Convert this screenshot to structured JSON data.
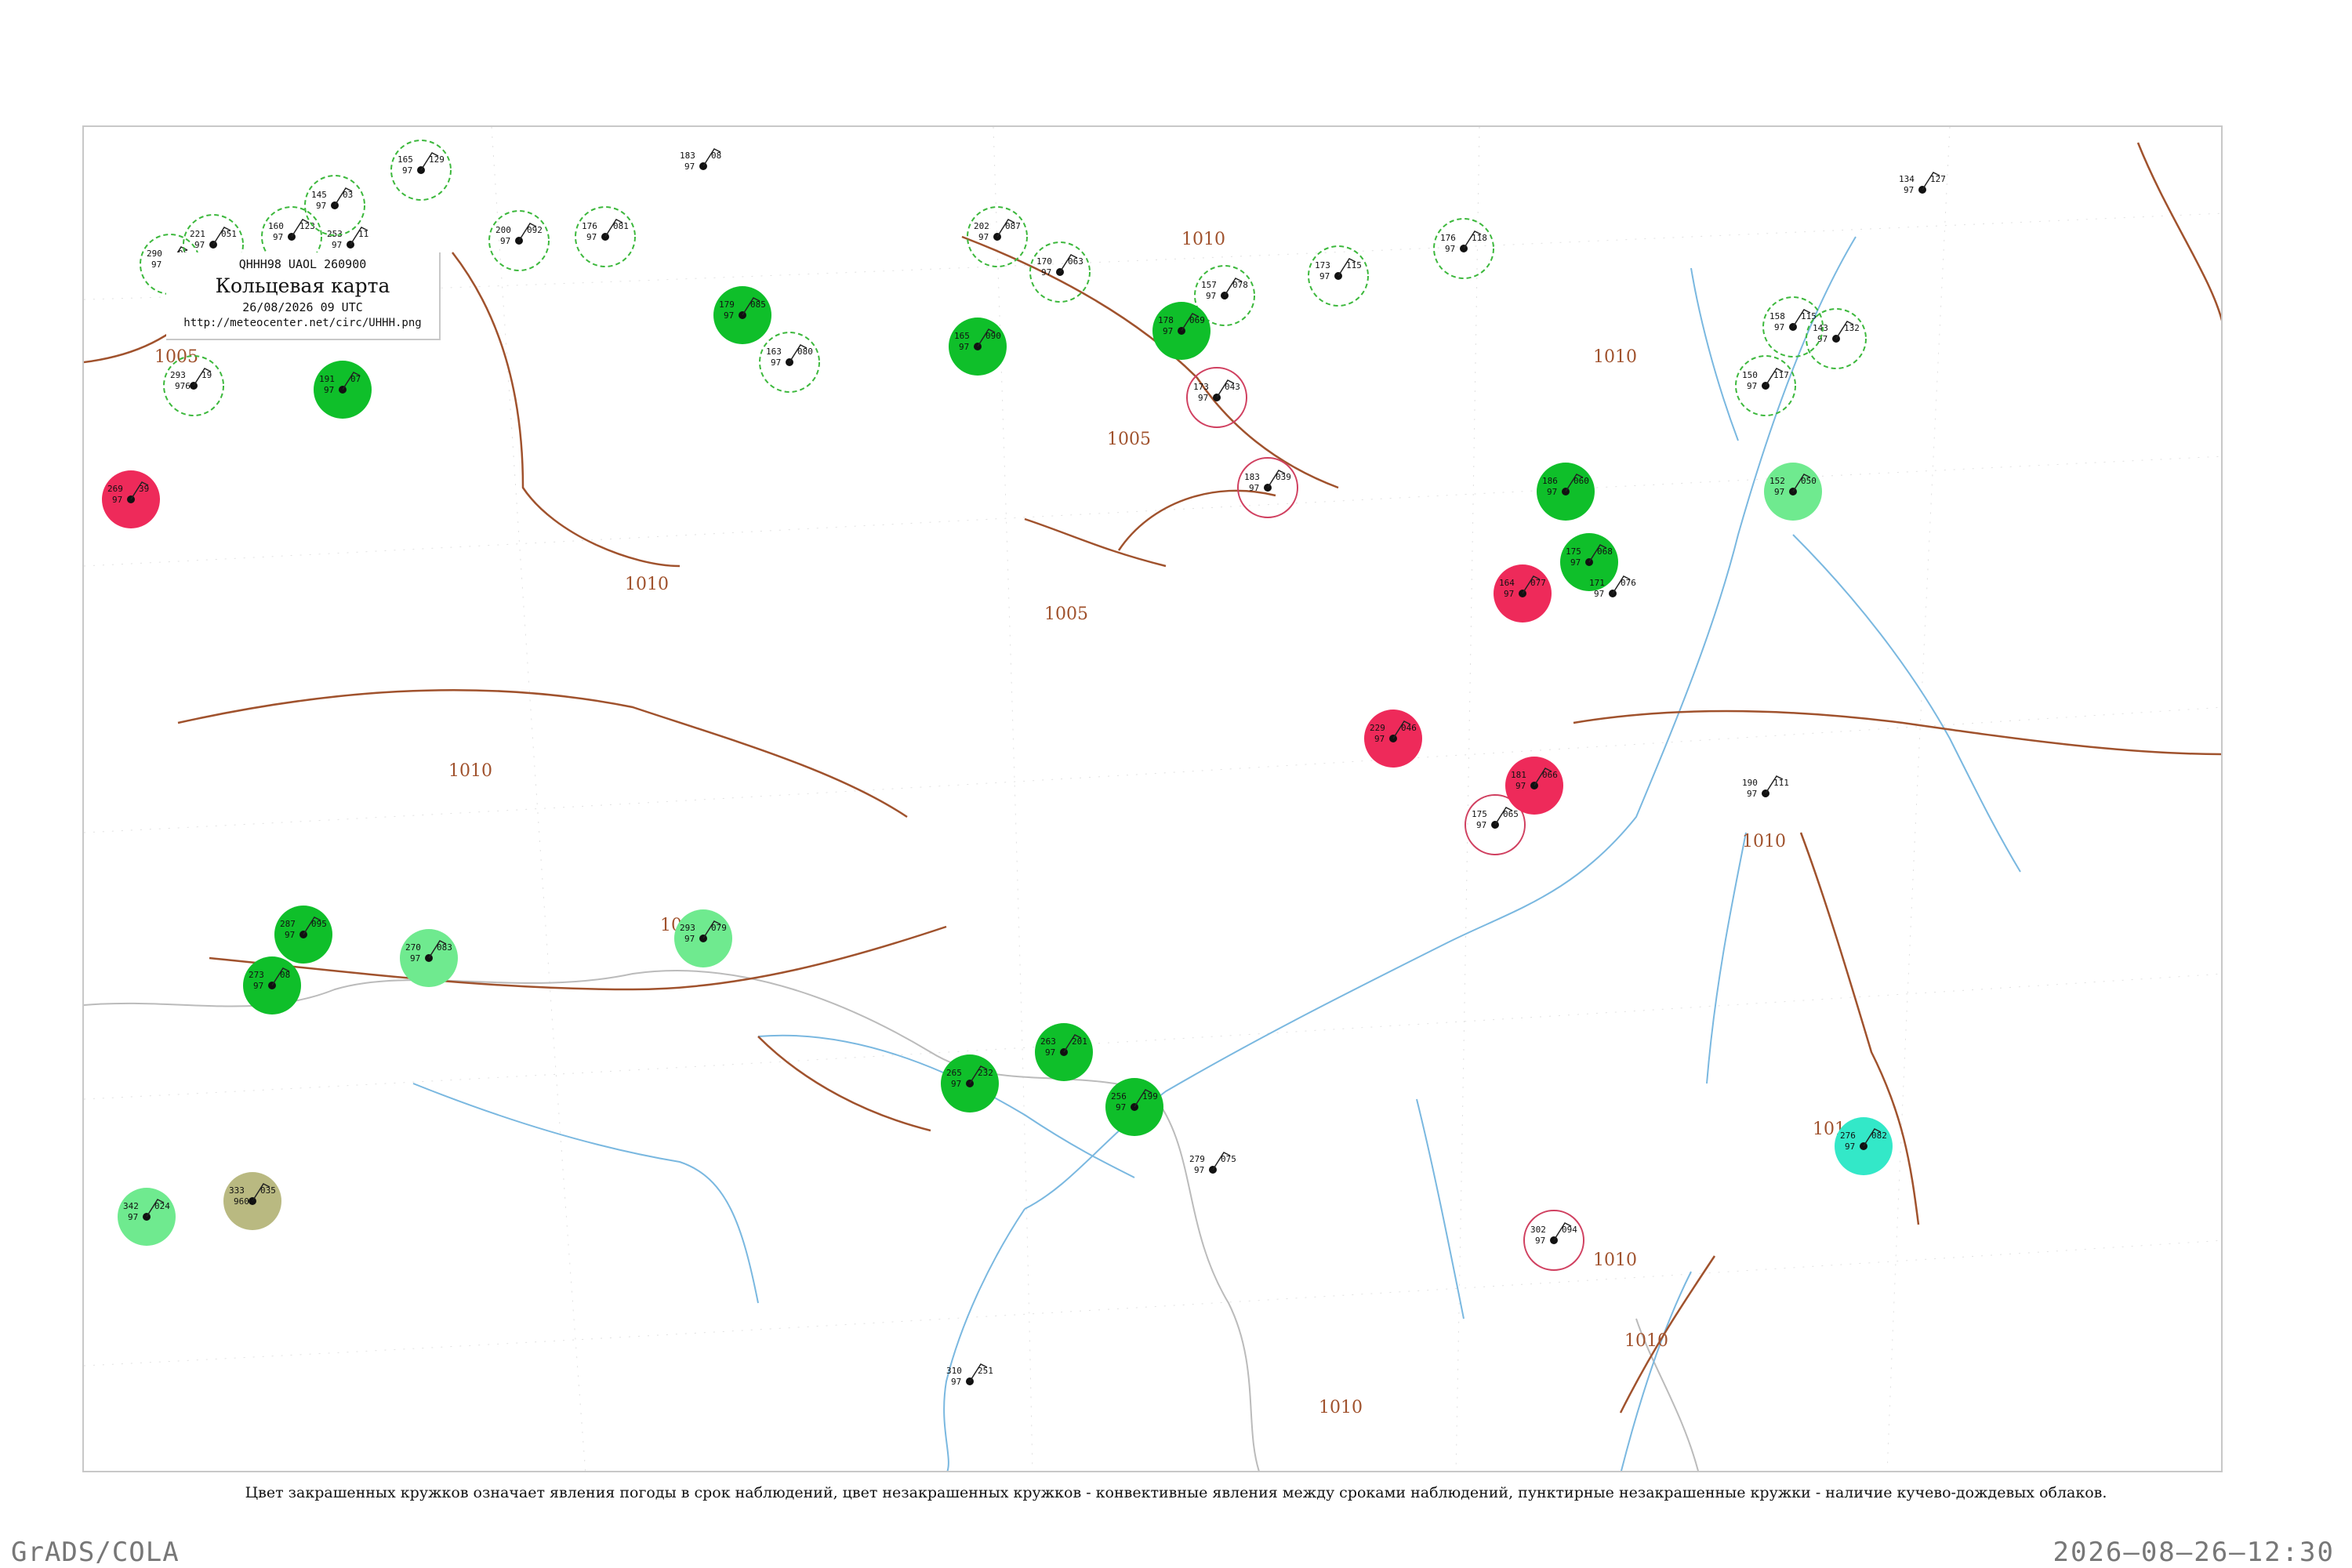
{
  "header": {
    "code_line": "QHHH98  UAOL  260900",
    "title": "Кольцевая карта",
    "date_line": "26/08/2026 09 UTC",
    "url": "http://meteocenter.net/circ/UHHH.png"
  },
  "caption": "Цвет закрашенных кружков означает явления погоды в срок наблюдений, цвет незакрашенных кружков - конвективные явления между сроками наблюдений, пунктирные незакрашенные кружки - наличие кучево-дождевых облаков.",
  "footer": {
    "left": "GrADS/COLA",
    "right": "2026–08–26–12:30"
  },
  "colors": {
    "frame": "#c8c8c8",
    "isobar": "#a0522d",
    "river": "#7ab8e0",
    "border": "#bbbbbb",
    "rain_fill": "#0fbf2a",
    "light_rain_fill": "#6fea8f",
    "thunder_fill": "#ee2a5a",
    "fog_fill": "#b9b981",
    "snow_fill": "#33e8c8",
    "cb_circle": "#3cb83c",
    "thunder_circle": "#d04060"
  },
  "map": {
    "isobar_labels": [
      "1005",
      "1010",
      "1010",
      "1005",
      "1010",
      "1010",
      "1005",
      "1010",
      "1010",
      "1010",
      "1010",
      "1010",
      "1010",
      "1010"
    ],
    "stations": [
      {
        "t": "253",
        "p": "97",
        "v": "11",
        "id": "31593",
        "mark": "none"
      },
      {
        "t": "269",
        "p": "97",
        "v": "39",
        "id": "",
        "mark": "thunder"
      },
      {
        "t": "293",
        "p": "976",
        "v": "19",
        "id": "",
        "mark": "cb"
      },
      {
        "t": "290",
        "p": "97",
        "v": "05",
        "id": "",
        "mark": "cb"
      },
      {
        "t": "221",
        "p": "97",
        "v": "051",
        "id": "",
        "mark": "cb"
      },
      {
        "t": "160",
        "p": "97",
        "v": "123",
        "id": "",
        "mark": "cb"
      },
      {
        "t": "145",
        "p": "97",
        "v": "03",
        "id": "",
        "mark": "cb"
      },
      {
        "t": "179",
        "p": "97",
        "v": "119",
        "id": "",
        "mark": "cb"
      },
      {
        "t": "191",
        "p": "97",
        "v": "07",
        "id": "",
        "mark": "rain"
      },
      {
        "t": "165",
        "p": "97",
        "v": "129",
        "id": "",
        "mark": "cb"
      },
      {
        "t": "200",
        "p": "97",
        "v": "092",
        "id": "",
        "mark": "cb"
      },
      {
        "t": "176",
        "p": "97",
        "v": "081",
        "id": "",
        "mark": "cb"
      },
      {
        "t": "183",
        "p": "97",
        "v": "08",
        "id": "",
        "mark": "none"
      },
      {
        "t": "202",
        "p": "97",
        "v": "087",
        "id": "",
        "mark": "cb"
      },
      {
        "t": "170",
        "p": "97",
        "v": "063",
        "id": "",
        "mark": "cb"
      },
      {
        "t": "157",
        "p": "97",
        "v": "078",
        "id": "",
        "mark": "cb"
      },
      {
        "t": "173",
        "p": "97",
        "v": "115",
        "id": "",
        "mark": "cb"
      },
      {
        "t": "176",
        "p": "97",
        "v": "118",
        "id": "",
        "mark": "cb"
      },
      {
        "t": "134",
        "p": "97",
        "v": "127",
        "id": "",
        "mark": "none"
      },
      {
        "t": "143",
        "p": "97",
        "v": "132",
        "id": "",
        "mark": "cb"
      },
      {
        "t": "158",
        "p": "97",
        "v": "115",
        "id": "",
        "mark": "cb"
      },
      {
        "t": "150",
        "p": "97",
        "v": "117",
        "id": "",
        "mark": "cb"
      },
      {
        "t": "165",
        "p": "97",
        "v": "090",
        "id": "",
        "mark": "rain"
      },
      {
        "t": "179",
        "p": "97",
        "v": "085",
        "id": "",
        "mark": "rain"
      },
      {
        "t": "163",
        "p": "97",
        "v": "080",
        "id": "",
        "mark": "cb"
      },
      {
        "t": "178",
        "p": "97",
        "v": "069",
        "id": "",
        "mark": "rain"
      },
      {
        "t": "173",
        "p": "97",
        "v": "043",
        "id": "",
        "mark": "thunder_ring"
      },
      {
        "t": "183",
        "p": "97",
        "v": "039",
        "id": "",
        "mark": "thunder_ring"
      },
      {
        "t": "175",
        "p": "97",
        "v": "065",
        "id": "",
        "mark": "thunder_ring"
      },
      {
        "t": "186",
        "p": "97",
        "v": "060",
        "id": "",
        "mark": "rain"
      },
      {
        "t": "175",
        "p": "97",
        "v": "068",
        "id": "",
        "mark": "rain"
      },
      {
        "t": "164",
        "p": "97",
        "v": "077",
        "id": "",
        "mark": "thunder"
      },
      {
        "t": "171",
        "p": "97",
        "v": "076",
        "id": "",
        "mark": "none"
      },
      {
        "t": "152",
        "p": "97",
        "v": "050",
        "id": "",
        "mark": "light_rain"
      },
      {
        "t": "229",
        "p": "97",
        "v": "046",
        "id": "",
        "mark": "thunder"
      },
      {
        "t": "181",
        "p": "97",
        "v": "066",
        "id": "",
        "mark": "thunder"
      },
      {
        "t": "190",
        "p": "97",
        "v": "111",
        "id": "",
        "mark": "none"
      },
      {
        "t": "287",
        "p": "97",
        "v": "095",
        "id": "",
        "mark": "rain"
      },
      {
        "t": "273",
        "p": "97",
        "v": "08",
        "id": "",
        "mark": "rain"
      },
      {
        "t": "293",
        "p": "97",
        "v": "079",
        "id": "",
        "mark": "light_rain"
      },
      {
        "t": "270",
        "p": "97",
        "v": "083",
        "id": "",
        "mark": "light_rain"
      },
      {
        "t": "302",
        "p": "97",
        "v": "094",
        "id": "",
        "mark": "thunder_ring"
      },
      {
        "t": "276",
        "p": "97",
        "v": "082",
        "id": "",
        "mark": "snow"
      },
      {
        "t": "342",
        "p": "97",
        "v": "024",
        "id": "",
        "mark": "light_rain"
      },
      {
        "t": "333",
        "p": "9600",
        "v": "035",
        "id": "",
        "mark": "fog"
      },
      {
        "t": "265",
        "p": "97",
        "v": "232",
        "id": "",
        "mark": "rain"
      },
      {
        "t": "256",
        "p": "97",
        "v": "199",
        "id": "",
        "mark": "rain"
      },
      {
        "t": "263",
        "p": "97",
        "v": "201",
        "id": "",
        "mark": "rain"
      },
      {
        "t": "279",
        "p": "97",
        "v": "075",
        "id": "",
        "mark": "none"
      },
      {
        "t": "310",
        "p": "97",
        "v": "251",
        "id": "",
        "mark": "none"
      }
    ]
  }
}
